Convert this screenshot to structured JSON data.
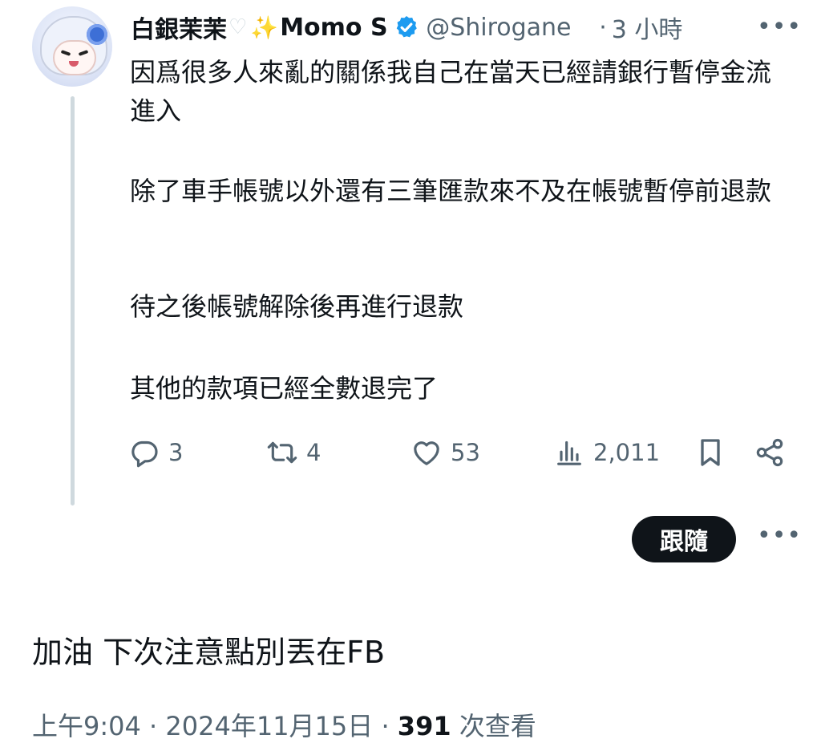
{
  "quoted_tweet": {
    "display_name": "白銀茉茉",
    "display_name_tail": "Momo S",
    "handle": "@Shirogane",
    "separator": "·",
    "time_ago": "3 小時",
    "paragraphs": [
      "因爲很多人來亂的關係我自己在當天已經請銀行暫停金流進入",
      "除了車手帳號以外還有三筆匯款來不及在帳號暫停前退款",
      "待之後帳號解除後再進行退款",
      "其他的款項已經全數退完了"
    ],
    "actions": {
      "replies": "3",
      "retweets": "4",
      "likes": "53",
      "views": "2,011"
    }
  },
  "follow_button_label": "跟隨",
  "more_label": "•••",
  "reply": {
    "text": "加油 下次注意點別丟在FB",
    "time": "上午9:04",
    "date": "2024年11月15日",
    "separator": "·",
    "view_count": "391",
    "view_label": "次查看"
  },
  "colors": {
    "text_primary": "#0f1419",
    "text_secondary": "#536471",
    "verified_blue": "#1d9bf0",
    "thread_line": "#cfd9de",
    "button_dark": "#0f1419"
  },
  "icons": [
    "white-heart-icon",
    "sparkles-icon",
    "verified-badge-icon",
    "reply-icon",
    "retweet-icon",
    "like-icon",
    "views-icon",
    "bookmark-icon",
    "share-icon",
    "more-icon"
  ]
}
